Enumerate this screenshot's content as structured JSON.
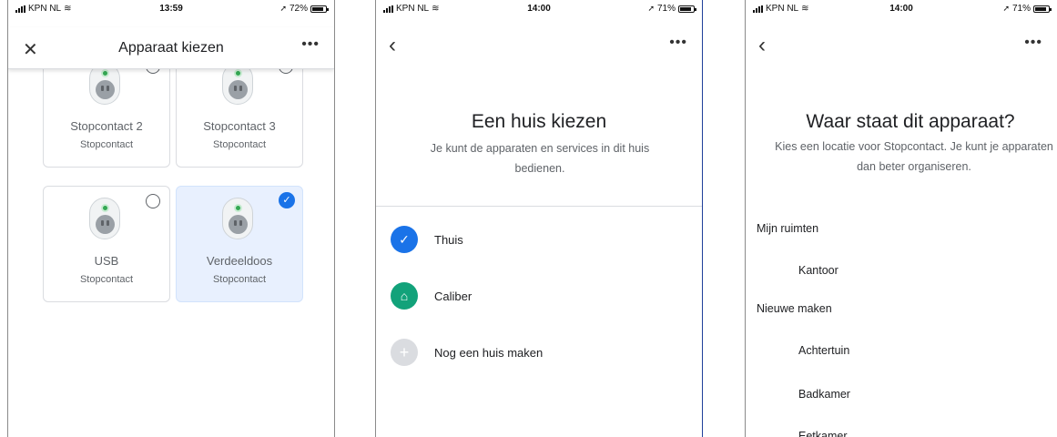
{
  "screens": [
    {
      "status": {
        "carrier": "KPN NL",
        "time": "13:59",
        "battery": "72%",
        "battery_level": 0.72
      },
      "header": {
        "title": "Apparaat kiezen"
      },
      "devices": [
        {
          "name": "Stopcontact 2",
          "type": "Stopcontact",
          "selected": false
        },
        {
          "name": "Stopcontact 3",
          "type": "Stopcontact",
          "selected": false
        },
        {
          "name": "USB",
          "type": "Stopcontact",
          "selected": false
        },
        {
          "name": "Verdeeldoos",
          "type": "Stopcontact",
          "selected": true
        }
      ]
    },
    {
      "status": {
        "carrier": "KPN NL",
        "time": "14:00",
        "battery": "71%",
        "battery_level": 0.71
      },
      "title": "Een huis kiezen",
      "subtitle": "Je kunt de apparaten en services in dit huis bedienen.",
      "homes": [
        {
          "label": "Thuis",
          "icon": "check-icon",
          "color": "#1a73e8"
        },
        {
          "label": "Caliber",
          "icon": "house-icon",
          "color": "#12a27a"
        },
        {
          "label": "Nog een huis maken",
          "icon": "plus-icon",
          "color": "#dadce0"
        }
      ]
    },
    {
      "status": {
        "carrier": "KPN NL",
        "time": "14:00",
        "battery": "71%",
        "battery_level": 0.71
      },
      "title": "Waar staat dit apparaat?",
      "subtitle": "Kies een locatie voor Stopcontact. Je kunt je apparaten dan beter organiseren.",
      "my_rooms_label": "Mijn ruimten",
      "my_rooms": [
        "Kantoor"
      ],
      "new_label": "Nieuwe maken",
      "new_rooms": [
        "Achtertuin",
        "Badkamer",
        "Eetkamer"
      ]
    }
  ],
  "colors": {
    "accent": "#1a73e8",
    "selected_bg": "#e8f0fe",
    "led": "#34a853"
  }
}
